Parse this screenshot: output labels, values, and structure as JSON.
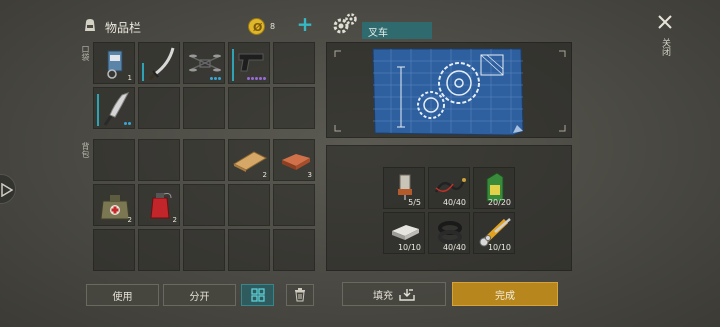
{
  "inventory": {
    "title": "物品栏",
    "coins": "8",
    "pocket_label": "口袋",
    "backpack_label": "背包",
    "pocket_slots": [
      {
        "icon": "radio-battery-icon",
        "qty": "1"
      },
      {
        "icon": "katana-icon",
        "qty": ""
      },
      {
        "icon": "drone-icon",
        "qty": ""
      },
      {
        "icon": "pistol-icon",
        "qty": ""
      },
      {
        "icon": "empty",
        "qty": ""
      },
      {
        "icon": "machete-icon",
        "qty": ""
      }
    ],
    "backpack_slots": [
      {
        "icon": "wood-plank-icon",
        "qty": "2"
      },
      {
        "icon": "copper-ingot-icon",
        "qty": "3"
      },
      {
        "icon": "medkit-bag-icon",
        "qty": "2"
      },
      {
        "icon": "red-bomb-icon",
        "qty": "2"
      }
    ]
  },
  "buttons": {
    "use": "使用",
    "split": "分开",
    "fill": "填充",
    "complete": "完成"
  },
  "blueprint": {
    "title": "叉车"
  },
  "requirements": [
    {
      "icon": "engine-part-icon",
      "qty": "5/5"
    },
    {
      "icon": "wires-icon",
      "qty": "40/40"
    },
    {
      "icon": "oil-canister-icon",
      "qty": "20/20"
    },
    {
      "icon": "aluminum-bar-icon",
      "qty": "10/10"
    },
    {
      "icon": "rubber-ring-icon",
      "qty": "40/40"
    },
    {
      "icon": "hydraulic-cylinder-icon",
      "qty": "10/10"
    }
  ],
  "close": {
    "label": "关闭"
  },
  "colors": {
    "accent_teal": "#2fa3b5",
    "complete_button": "#c8921c",
    "coin_gold": "#e0b62a"
  }
}
